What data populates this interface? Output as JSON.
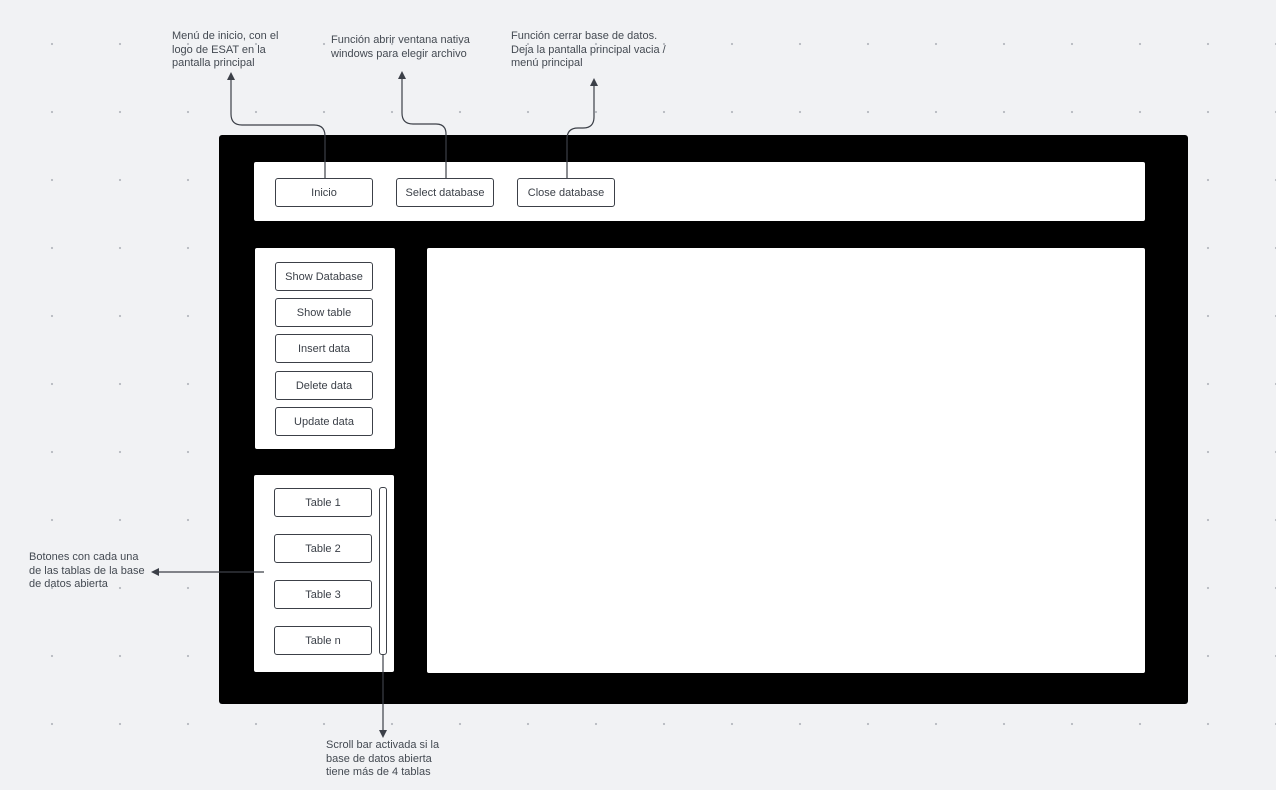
{
  "annotations": {
    "inicio": "Menú de inicio, con el\nlogo de ESAT en la\npantalla principal",
    "select": "Función abrir ventana nativa\nwindows para elegir archivo",
    "close": "Función cerrar base de datos.\nDeja la pantalla principal vacia /\nmenú principal",
    "tables": "Botones con cada una\nde las tablas de la base\nde datos abierta",
    "scroll": "Scroll bar activada si la\nbase de datos abierta\ntiene más de 4 tablas"
  },
  "topbar": {
    "inicio": "Inicio",
    "select_database": "Select database",
    "close_database": "Close database"
  },
  "actions": [
    "Show Database",
    "Show table",
    "Insert data",
    "Delete data",
    "Update data"
  ],
  "tables": [
    "Table 1",
    "Table 2",
    "Table 3",
    "Table n"
  ],
  "colors": {
    "frame": "#000000",
    "canvas": "#f1f2f4",
    "stroke": "#3c4048"
  }
}
